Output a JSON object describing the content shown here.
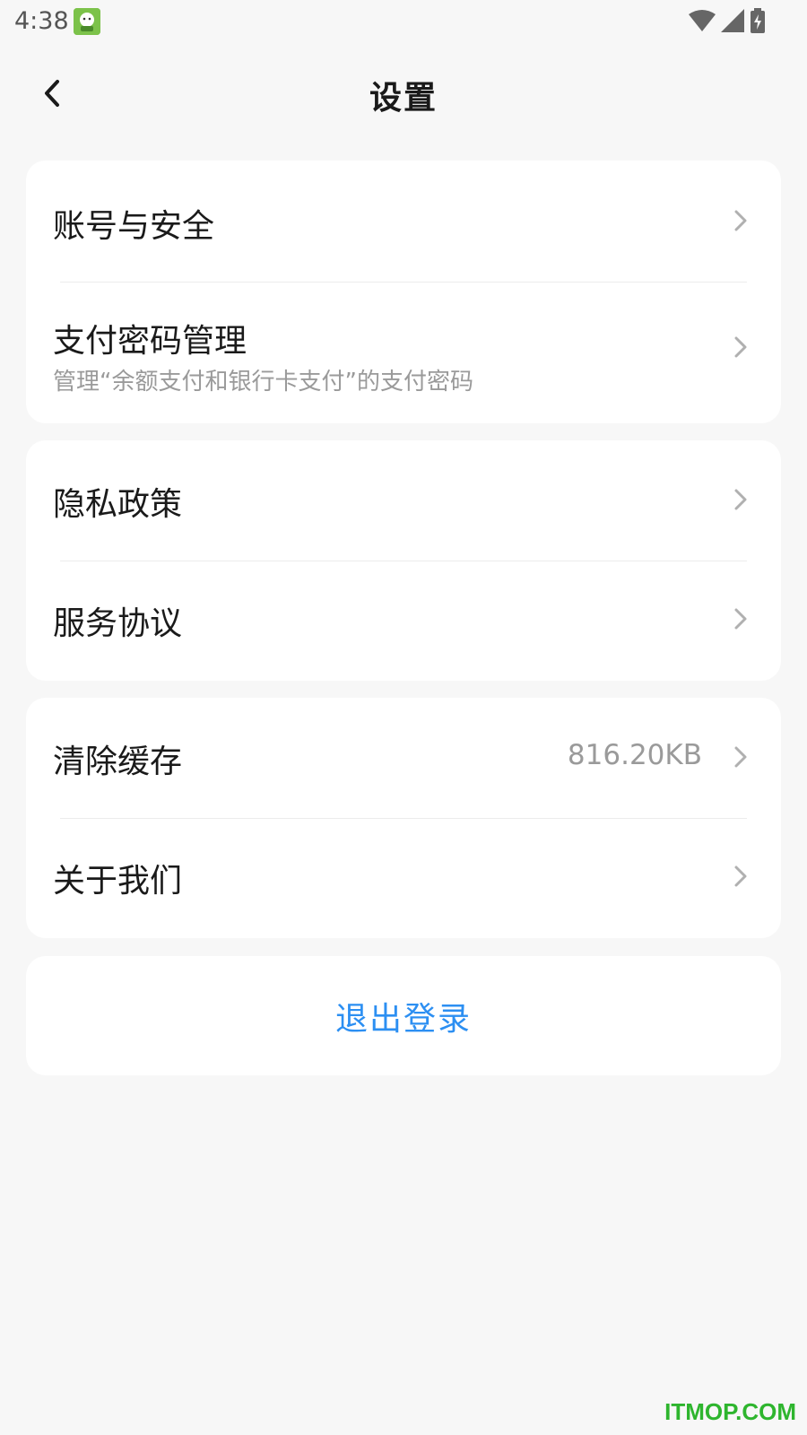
{
  "status_bar": {
    "time": "4:38",
    "icons": [
      "app-notification-icon",
      "wifi-icon",
      "signal-icon",
      "battery-charging-icon"
    ]
  },
  "nav": {
    "back_icon": "chevron-left-icon",
    "title": "设置"
  },
  "groups": [
    {
      "items": [
        {
          "label": "账号与安全"
        },
        {
          "label": "支付密码管理",
          "subtitle": "管理“余额支付和银行卡支付”的支付密码"
        }
      ]
    },
    {
      "items": [
        {
          "label": "隐私政策"
        },
        {
          "label": "服务协议"
        }
      ]
    },
    {
      "items": [
        {
          "label": "清除缓存",
          "value": "816.20KB"
        },
        {
          "label": "关于我们"
        }
      ]
    }
  ],
  "logout": {
    "label": "退出登录"
  },
  "watermark": "ITMOP.COM",
  "colors": {
    "background": "#f7f7f7",
    "card": "#ffffff",
    "accent": "#2c8ff2",
    "secondary_text": "#9a9a9a",
    "watermark": "#2eb52e"
  }
}
